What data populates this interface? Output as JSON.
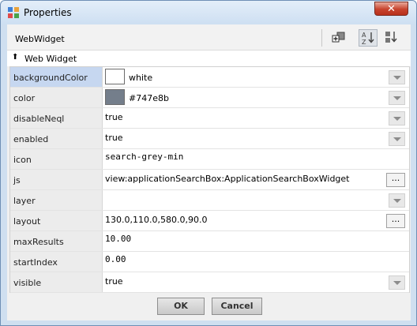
{
  "window": {
    "title": "Properties",
    "close_glyph": "✕"
  },
  "header": {
    "title": "WebWidget"
  },
  "group": {
    "label": "Web Widget",
    "collapse_icon": "double-chevron-up-icon"
  },
  "properties": [
    {
      "name": "backgroundColor",
      "value": "white",
      "editor": "dropdown",
      "swatch": "#ffffff",
      "selected": true
    },
    {
      "name": "color",
      "value": "#747e8b",
      "editor": "dropdown",
      "swatch": "#747e8b"
    },
    {
      "name": "disableNeql",
      "value": "true",
      "editor": "dropdown"
    },
    {
      "name": "enabled",
      "value": "true",
      "editor": "dropdown"
    },
    {
      "name": "icon",
      "value": "search-grey-min",
      "editor": "text",
      "mono": true
    },
    {
      "name": "js",
      "value": "view:applicationSearchBox:ApplicationSearchBoxWidget",
      "editor": "ellipsis"
    },
    {
      "name": "layer",
      "value": "",
      "editor": "dropdown"
    },
    {
      "name": "layout",
      "value": "130.0,110.0,580.0,90.0",
      "editor": "ellipsis"
    },
    {
      "name": "maxResults",
      "value": "10.00",
      "editor": "text",
      "mono": true
    },
    {
      "name": "startIndex",
      "value": "0.00",
      "editor": "text",
      "mono": true
    },
    {
      "name": "visible",
      "value": "true",
      "editor": "dropdown"
    }
  ],
  "buttons": {
    "ok": "OK",
    "cancel": "Cancel",
    "ellipsis": "..."
  },
  "colors": {
    "selection": "#c6d7f0",
    "frame": "#cfdff0",
    "close": "#c7432d"
  }
}
